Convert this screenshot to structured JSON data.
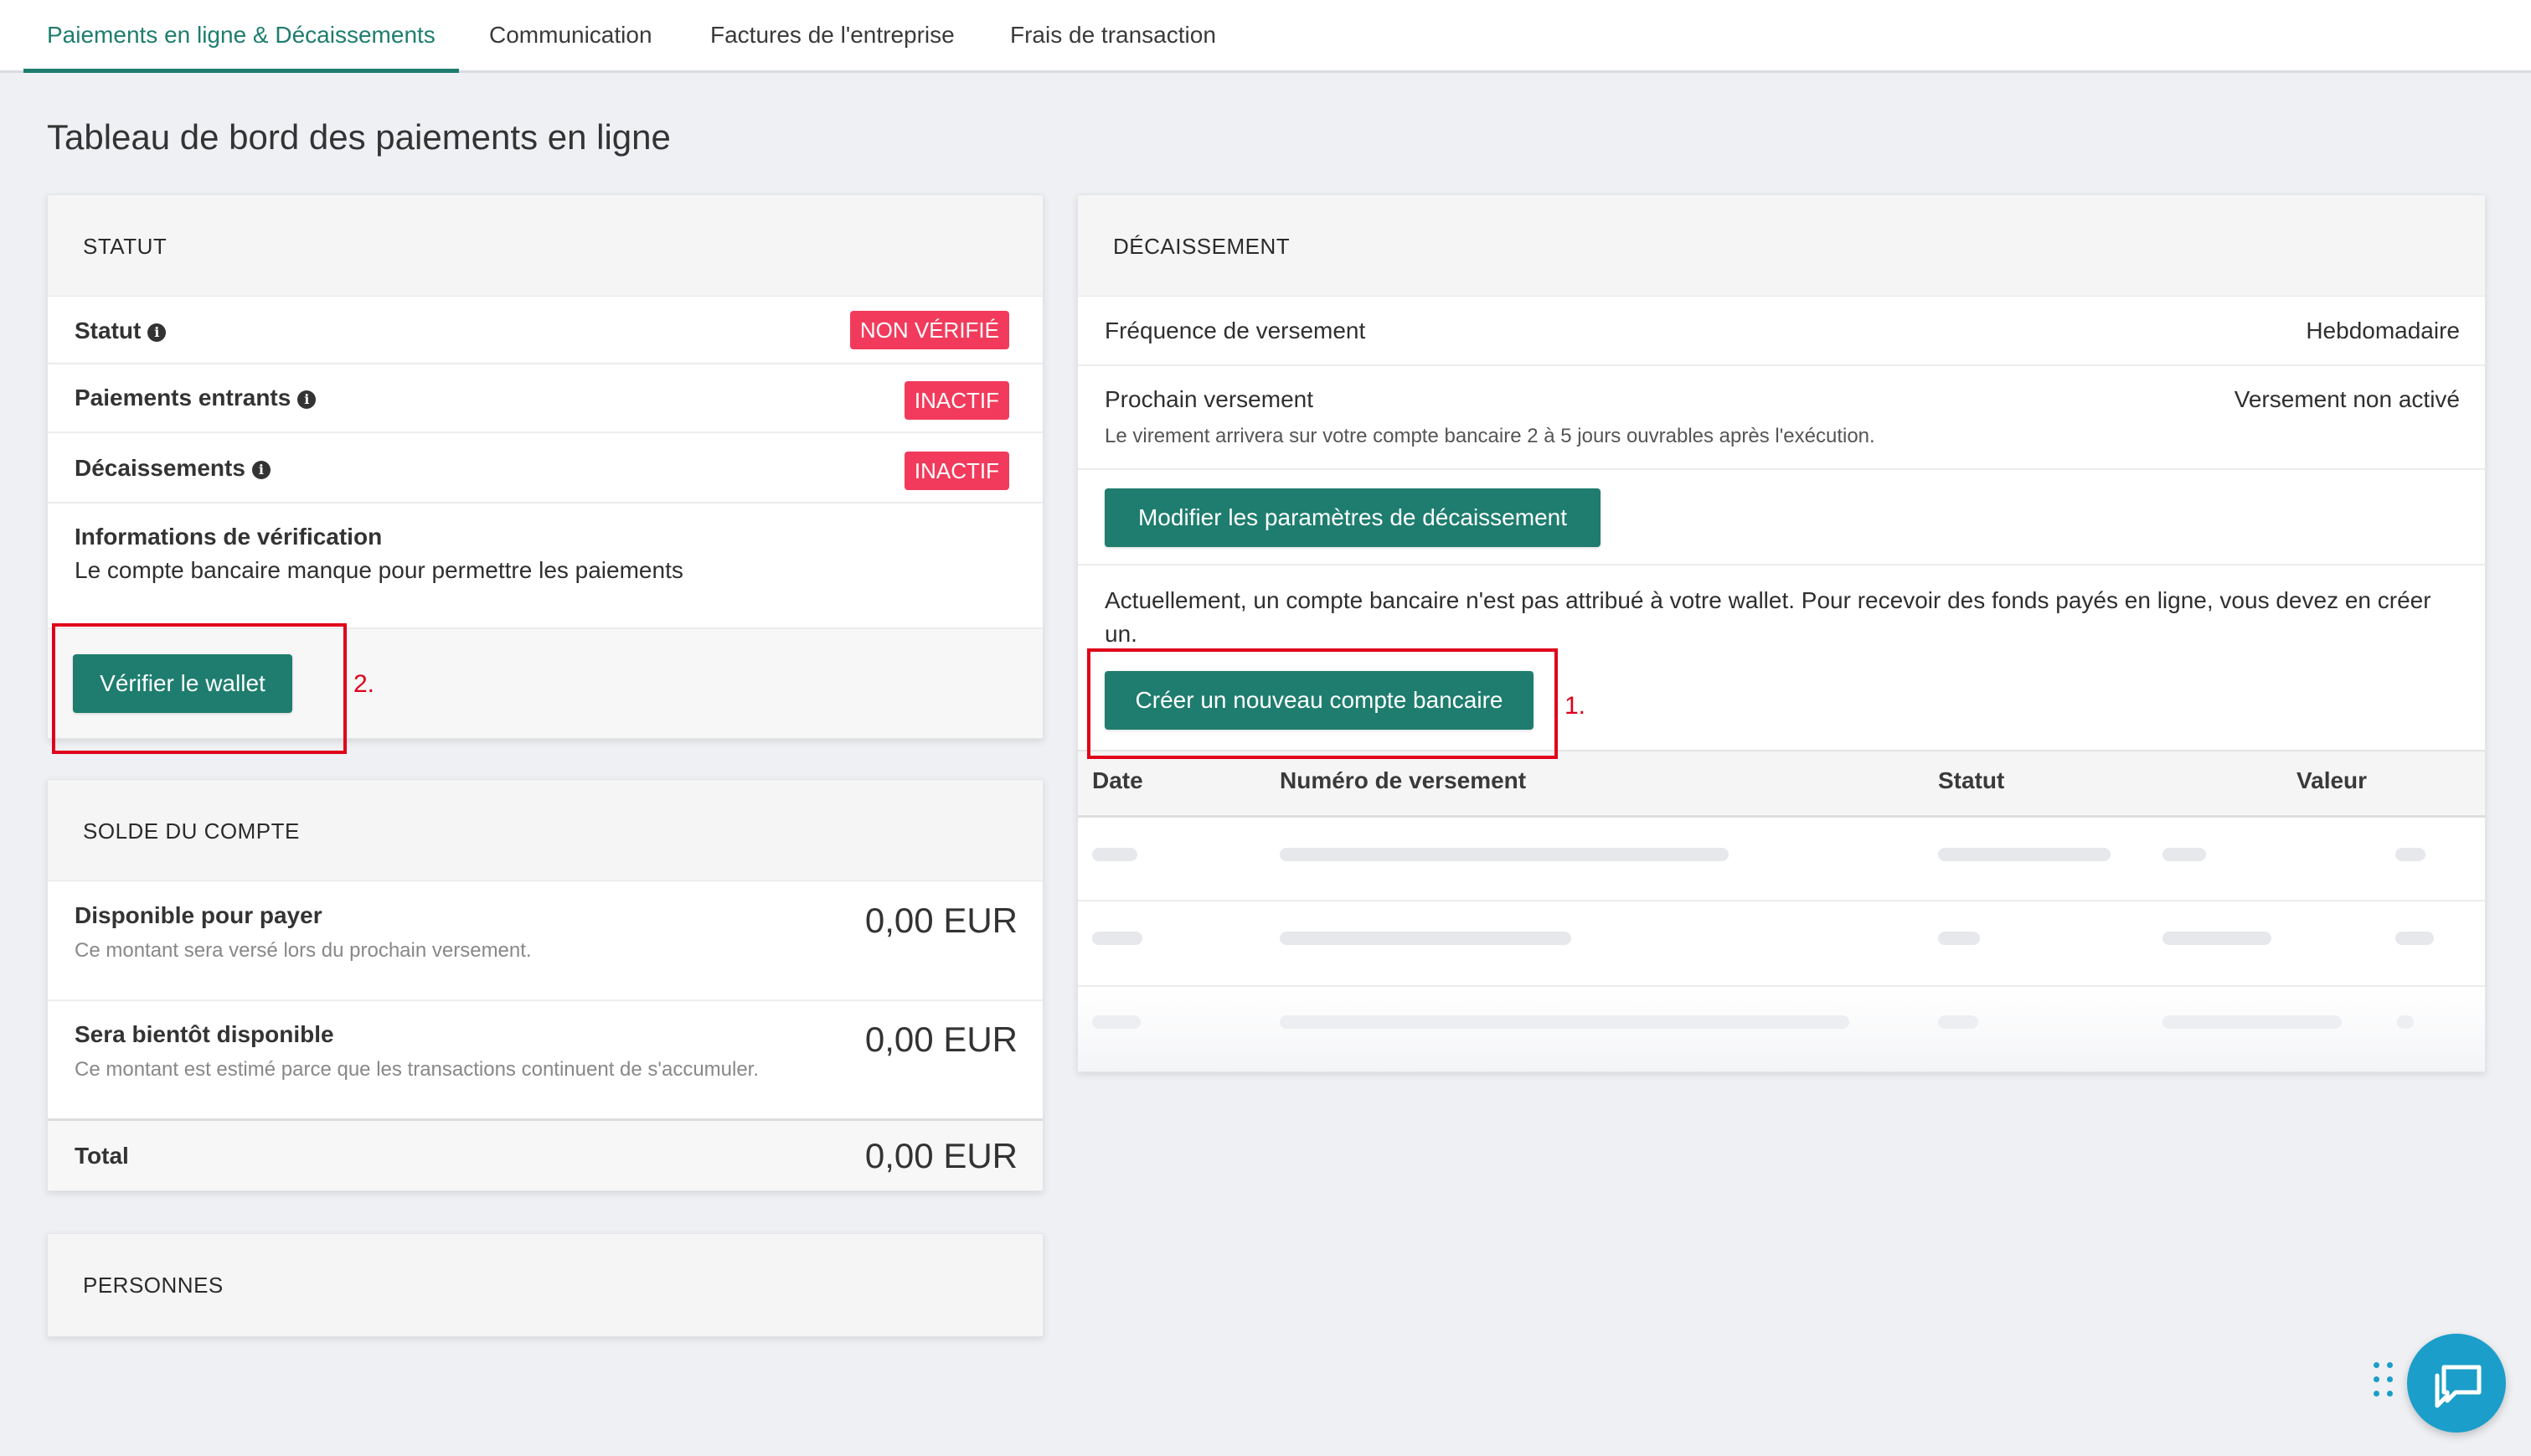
{
  "tabs": [
    {
      "label": "Paiements en ligne & Décaissements"
    },
    {
      "label": "Communication"
    },
    {
      "label": "Factures de l'entreprise"
    },
    {
      "label": "Frais de transaction"
    }
  ],
  "page_title": "Tableau de bord des paiements en ligne",
  "statut": {
    "header": "STATUT",
    "rows": [
      {
        "label": "Statut",
        "badge": "NON VÉRIFIÉ"
      },
      {
        "label": "Paiements entrants",
        "badge": "INACTIF"
      },
      {
        "label": "Décaissements",
        "badge": "INACTIF"
      }
    ],
    "verification_title": "Informations de vérification",
    "verification_text": "Le compte bancaire manque pour permettre les paiements",
    "verify_button": "Vérifier le wallet",
    "annotation": "2."
  },
  "solde": {
    "header": "SOLDE DU COMPTE",
    "available_label": "Disponible pour payer",
    "available_sub": "Ce montant sera versé lors du prochain versement.",
    "available_amount": "0,00 EUR",
    "soon_label": "Sera bientôt disponible",
    "soon_sub": "Ce montant est estimé parce que les transactions continuent de s'accumuler.",
    "soon_amount": "0,00 EUR",
    "total_label": "Total",
    "total_amount": "0,00 EUR"
  },
  "personnes": {
    "header": "PERSONNES"
  },
  "decaissement": {
    "header": "DÉCAISSEMENT",
    "frequency_label": "Fréquence de versement",
    "frequency_value": "Hebdomadaire",
    "next_label": "Prochain versement",
    "next_value": "Versement non activé",
    "next_sub": "Le virement arrivera sur votre compte bancaire 2 à 5 jours ouvrables après l'exécution.",
    "modify_button": "Modifier les paramètres de décaissement",
    "notice": "Actuellement, un compte bancaire n'est pas attribué à votre wallet. Pour recevoir des fonds payés en ligne, vous devez en créer un.",
    "create_button": "Créer un nouveau compte bancaire",
    "annotation": "1.",
    "table_headers": {
      "date": "Date",
      "number": "Numéro de versement",
      "status": "Statut",
      "value": "Valeur"
    }
  },
  "colors": {
    "accent": "#1e7d6e",
    "badge": "#f23b5c",
    "annotation": "#e0001a",
    "chat": "#1b9ec9"
  },
  "icons": {
    "info": "info-icon",
    "chat": "chat-icon",
    "grid": "grid-dots-icon"
  }
}
